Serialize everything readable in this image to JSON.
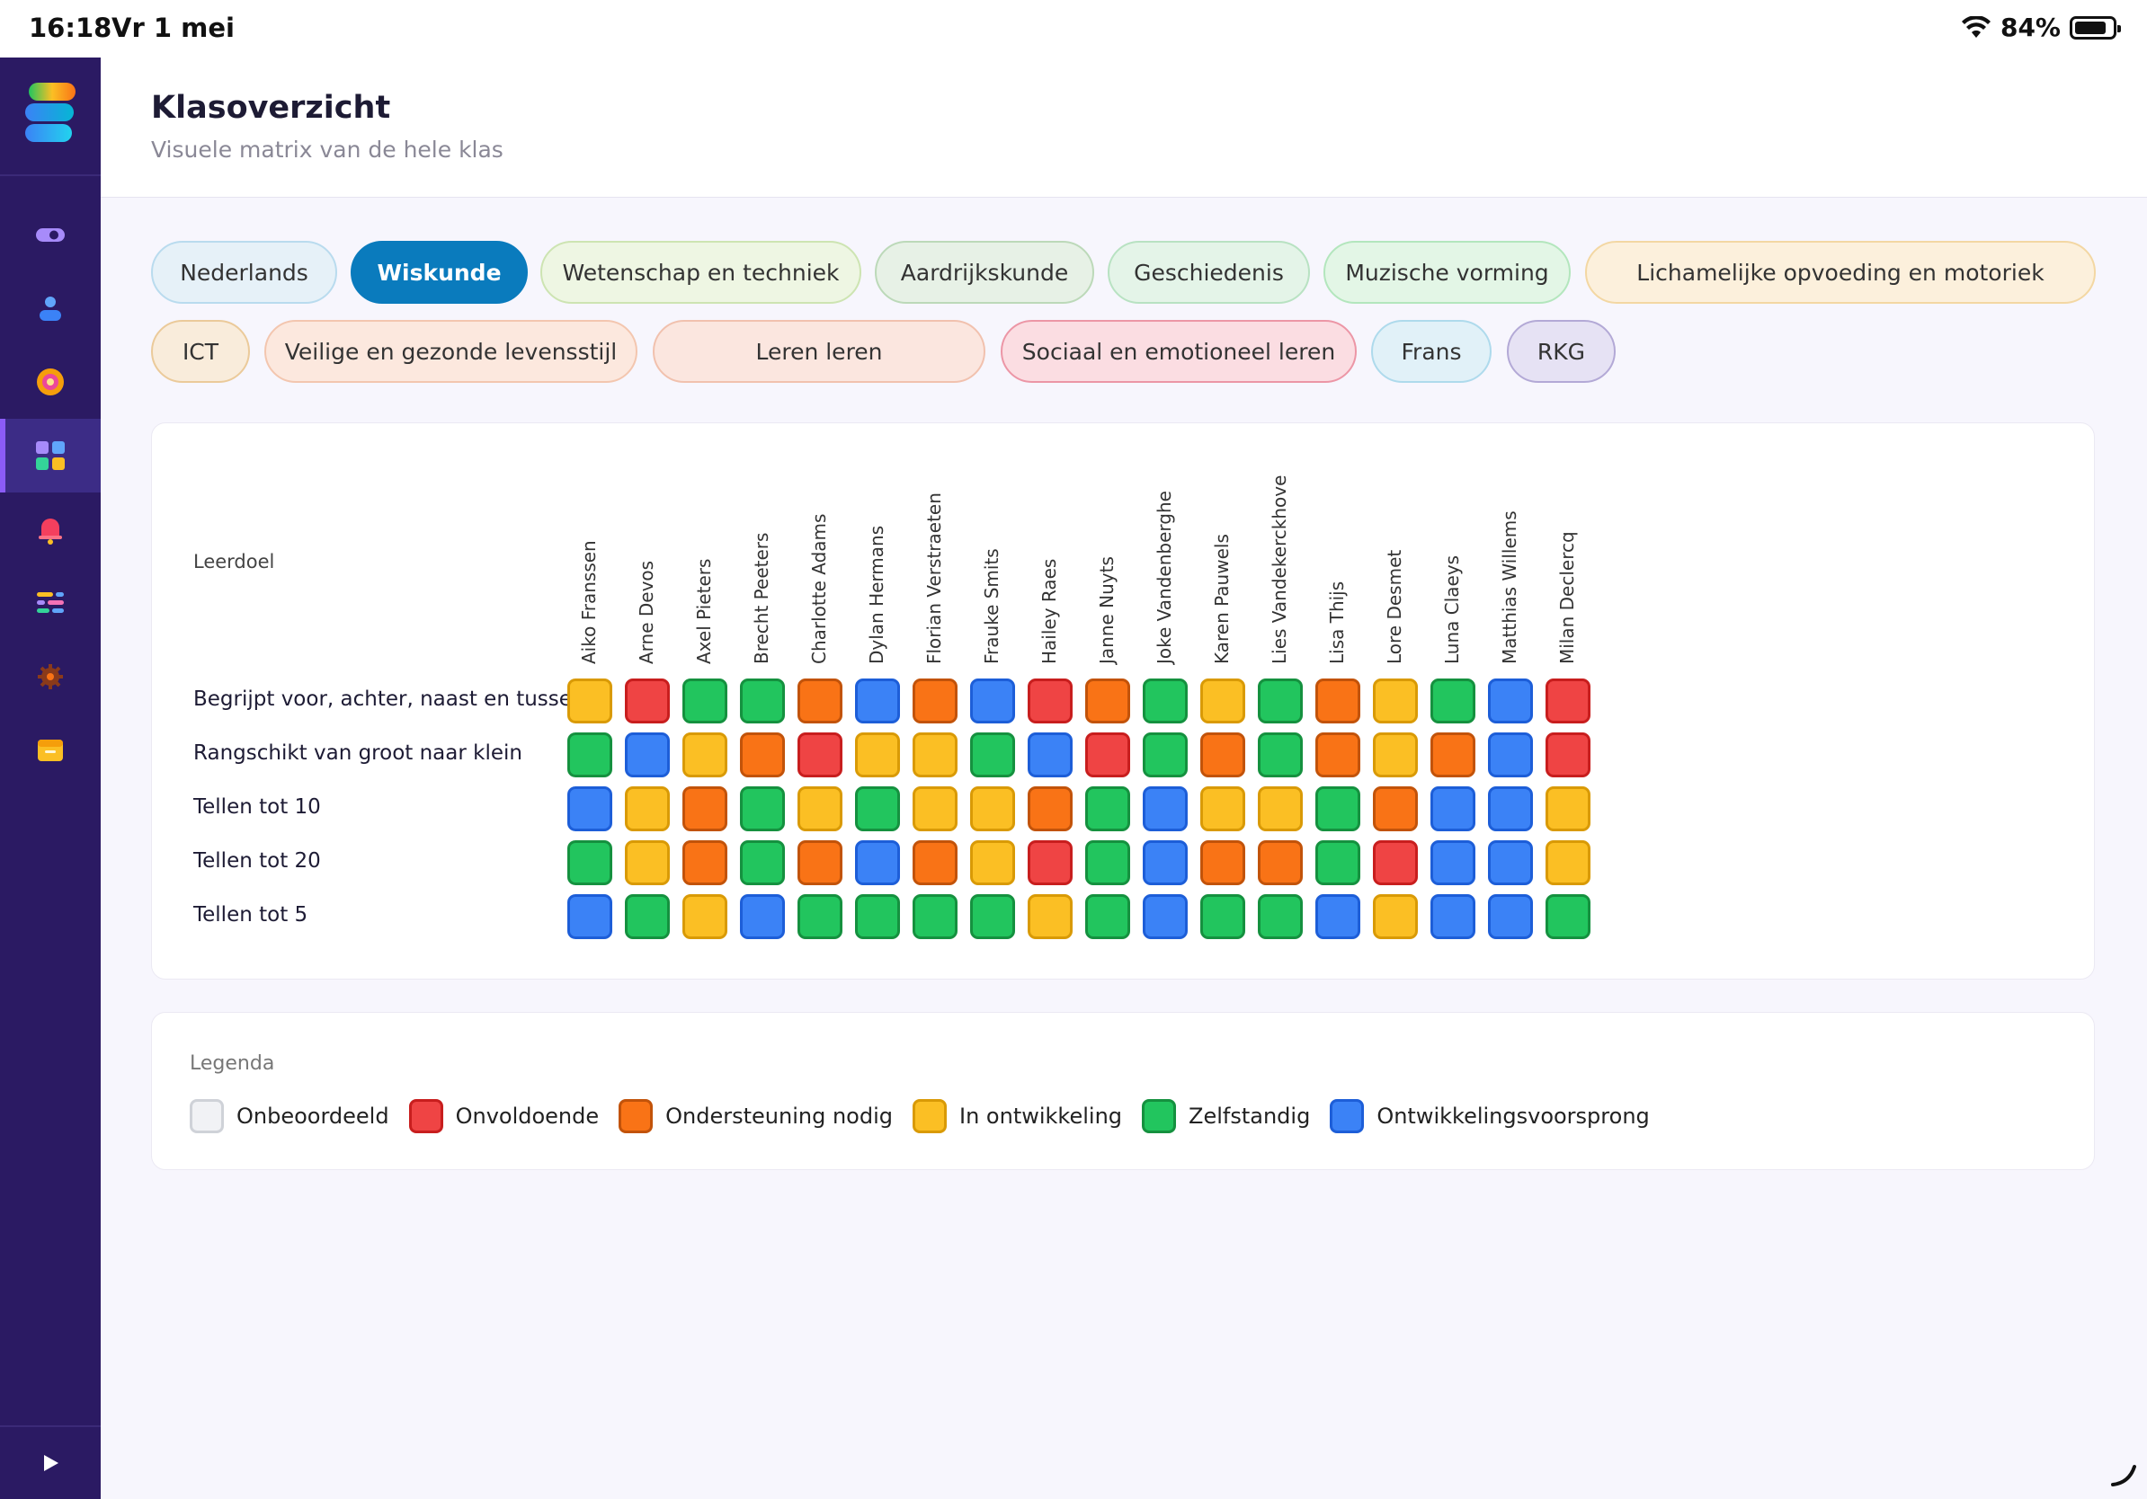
{
  "status": {
    "time": "16:18",
    "date": "Vr 1 mei",
    "battery": "84%",
    "battery_level": 0.84
  },
  "header": {
    "title": "Klasoverzicht",
    "subtitle": "Visuele matrix van de hele klas"
  },
  "subjects": [
    {
      "label": "Nederlands",
      "bg": "#e6f1f8",
      "border": "#b9dbee",
      "active": false
    },
    {
      "label": "Wiskunde",
      "bg": "#0a7bbd",
      "border": "#0a7bbd",
      "active": true
    },
    {
      "label": "Wetenschap en techniek",
      "bg": "#eef6e3",
      "border": "#cde4b2",
      "active": false
    },
    {
      "label": "Aardrijkskunde",
      "bg": "#e7f1e6",
      "border": "#bcd9b9",
      "active": false
    },
    {
      "label": "Geschiedenis",
      "bg": "#e4f4e8",
      "border": "#b8e2c2",
      "active": false
    },
    {
      "label": "Muzische vorming",
      "bg": "#e3f6e6",
      "border": "#b3e6bd",
      "active": false
    },
    {
      "label": "Lichamelijke opvoeding en motoriek",
      "bg": "#fcf0dc",
      "border": "#f3d7a3",
      "active": false
    },
    {
      "label": "ICT",
      "bg": "#f9ecdb",
      "border": "#ebca9a",
      "active": false
    },
    {
      "label": "Veilige en gezonde levensstijl",
      "bg": "#fce8de",
      "border": "#f3c6af",
      "active": false
    },
    {
      "label": "Leren leren",
      "bg": "#fbe6df",
      "border": "#f1c1ae",
      "active": false
    },
    {
      "label": "Sociaal en emotioneel leren",
      "bg": "#fbdde2",
      "border": "#ec96a6",
      "active": false
    },
    {
      "label": "Frans",
      "bg": "#e1f1f8",
      "border": "#aedaec",
      "active": false
    },
    {
      "label": "RKG",
      "bg": "#e6e2f4",
      "border": "#b3a9d6",
      "active": false
    }
  ],
  "matrix": {
    "leerdoel_header": "Leerdoel",
    "students": [
      "Aiko Franssen",
      "Arne Devos",
      "Axel Pieters",
      "Brecht Peeters",
      "Charlotte Adams",
      "Dylan Hermans",
      "Florian Verstraeten",
      "Frauke Smits",
      "Hailey Raes",
      "Janne Nuyts",
      "Joke Vandenberghe",
      "Karen Pauwels",
      "Lies Vandekerckhove",
      "Lisa Thijs",
      "Lore Desmet",
      "Luna Claeys",
      "Matthias Willems",
      "Milan Declercq"
    ],
    "goals": [
      {
        "label": "Begrijpt voor, achter, naast en tussen",
        "scores": [
          "Y",
          "R",
          "G",
          "G",
          "O",
          "B",
          "O",
          "B",
          "R",
          "O",
          "G",
          "Y",
          "G",
          "O",
          "Y",
          "G",
          "B",
          "R"
        ]
      },
      {
        "label": "Rangschikt van groot naar klein",
        "scores": [
          "G",
          "B",
          "Y",
          "O",
          "R",
          "Y",
          "Y",
          "G",
          "B",
          "R",
          "G",
          "O",
          "G",
          "O",
          "Y",
          "O",
          "B",
          "R"
        ]
      },
      {
        "label": "Tellen tot 10",
        "scores": [
          "B",
          "Y",
          "O",
          "G",
          "Y",
          "G",
          "Y",
          "Y",
          "O",
          "G",
          "B",
          "Y",
          "Y",
          "G",
          "O",
          "B",
          "B",
          "Y"
        ]
      },
      {
        "label": "Tellen tot 20",
        "scores": [
          "G",
          "Y",
          "O",
          "G",
          "O",
          "B",
          "O",
          "Y",
          "R",
          "G",
          "B",
          "O",
          "O",
          "G",
          "R",
          "B",
          "B",
          "Y"
        ]
      },
      {
        "label": "Tellen tot 5",
        "scores": [
          "B",
          "G",
          "Y",
          "B",
          "G",
          "G",
          "G",
          "G",
          "Y",
          "G",
          "B",
          "G",
          "G",
          "B",
          "Y",
          "B",
          "B",
          "G"
        ]
      }
    ]
  },
  "levels": {
    "N": {
      "label": "Onbeoordeeld",
      "fill": "#f1f2f5",
      "border": "#cfd2d8"
    },
    "R": {
      "label": "Onvoldoende",
      "fill": "#ef4444",
      "border": "#c81e1e"
    },
    "O": {
      "label": "Ondersteuning nodig",
      "fill": "#f97316",
      "border": "#c2530a"
    },
    "Y": {
      "label": "In ontwikkeling",
      "fill": "#fbbf24",
      "border": "#d99a06"
    },
    "G": {
      "label": "Zelfstandig",
      "fill": "#22c55e",
      "border": "#15913f"
    },
    "B": {
      "label": "Ontwikkelingsvoorsprong",
      "fill": "#3b82f6",
      "border": "#1d5ed8"
    }
  },
  "legend": {
    "title": "Legenda",
    "order": [
      "N",
      "R",
      "O",
      "Y",
      "G",
      "B"
    ]
  },
  "nav_icons": [
    "toggle-icon",
    "user-icon",
    "target-icon",
    "dashboard-icon",
    "bell-icon",
    "sliders-icon",
    "gear-icon",
    "folder-icon"
  ]
}
